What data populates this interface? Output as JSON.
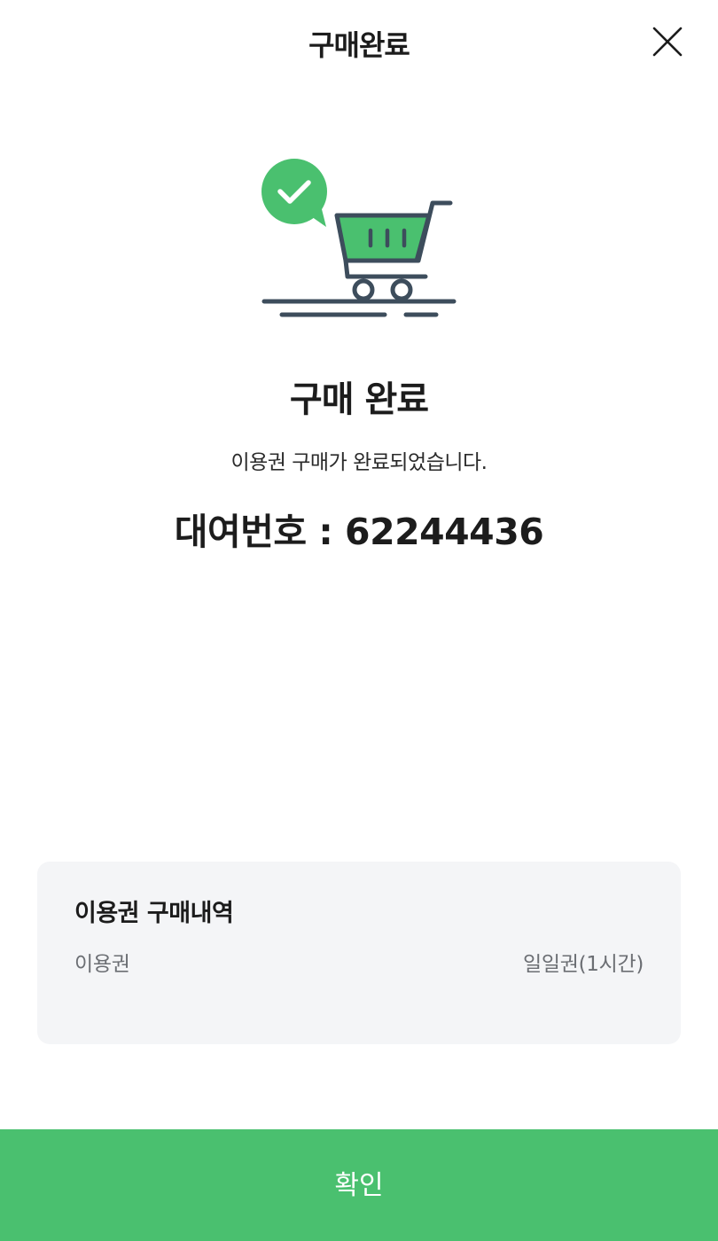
{
  "header": {
    "title": "구매완료",
    "close_icon": "close-icon"
  },
  "illustration": {
    "icon": "shopping-cart-check-icon",
    "accent_color": "#4ac06f",
    "stroke_color": "#3d4d5c"
  },
  "main": {
    "title": "구매 완료",
    "message": "이용권 구매가 완료되었습니다.",
    "rental_number_text": "대여번호 : 62244436"
  },
  "history": {
    "title": "이용권 구매내역",
    "rows": [
      {
        "label": "이용권",
        "value": "일일권(1시간)"
      }
    ]
  },
  "footer": {
    "confirm_label": "확인",
    "button_color": "#4ac06f"
  }
}
